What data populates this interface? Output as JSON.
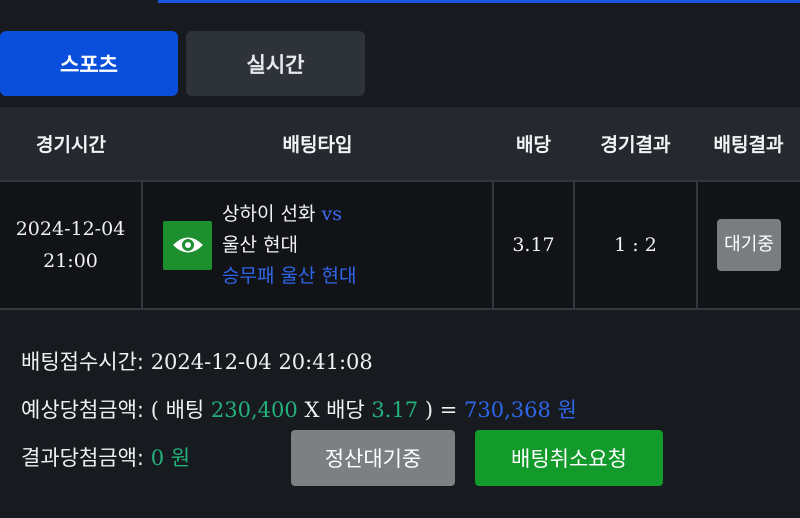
{
  "tabs": [
    {
      "label": "스포츠",
      "active": true
    },
    {
      "label": "실시간",
      "active": false
    }
  ],
  "table": {
    "headers": [
      "경기시간",
      "배팅타입",
      "배당",
      "경기결과",
      "배팅결과"
    ],
    "row": {
      "date": "2024-12-04",
      "time": "21:00",
      "home_team": "상하이 선화",
      "vs": "vs",
      "away_team": "울산 현대",
      "pick": "승무패 울산 현대",
      "odds": "3.17",
      "score": "1 : 2",
      "result_label": "대기중",
      "icon": "eye-icon"
    }
  },
  "info": {
    "accepted_label": "배팅접수시간:",
    "accepted_time": "2024-12-04 20:41:08",
    "expected_label": "예상당첨금액:",
    "open_paren": "(",
    "bet_label": "배팅",
    "bet_amount": "230,400",
    "times": "X",
    "odds_label": "배당",
    "odds": "3.17",
    "close_eq": ") =",
    "expected_amount": "730,368",
    "won1": "원",
    "result_label": "결과당첨금액:",
    "result_amount": "0",
    "won2": "원"
  },
  "buttons": {
    "settle_wait": "정산대기중",
    "cancel_request": "배팅취소요청"
  },
  "colors": {
    "accent_blue": "#0a4fdc",
    "green": "#129a2a",
    "amount_green": "#23b07a",
    "link_blue": "#2f66e8"
  }
}
